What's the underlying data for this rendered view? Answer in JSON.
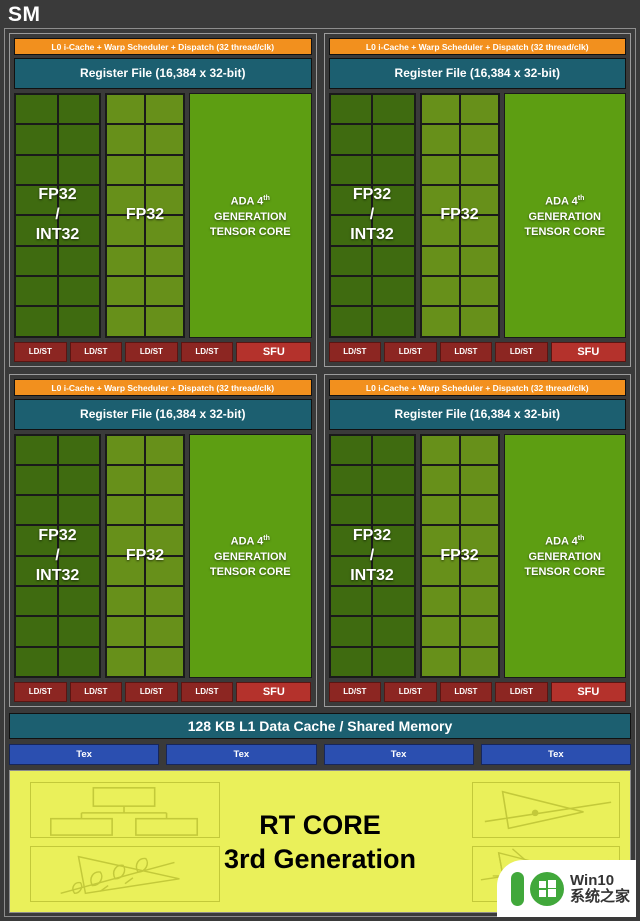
{
  "diagram": {
    "title": "SM",
    "subsections": {
      "scheduler_label": "L0 i-Cache + Warp Scheduler + Dispatch (32 thread/clk)",
      "register_file_label": "Register File (16,384 x 32-bit)",
      "fp32_int32_label_line1": "FP32",
      "fp32_int32_label_line2": "/",
      "fp32_int32_label_line3": "INT32",
      "fp32_label": "FP32",
      "tensor_core_line1_prefix": "ADA 4",
      "tensor_core_line1_sup": "th",
      "tensor_core_line2": "GENERATION",
      "tensor_core_line3": "TENSOR CORE",
      "ldst_label": "LD/ST",
      "sfu_label": "SFU"
    },
    "l1_cache_label": "128 KB L1 Data Cache / Shared Memory",
    "tex_label": "Tex",
    "tex_count": 4,
    "rt_core": {
      "line1": "RT CORE",
      "line2": "3rd Generation",
      "icons": [
        "bvh-tree-icon",
        "triangle-foliage-icon",
        "ray-triangle-intersection-icon",
        "ray-mesh-intersection-icon"
      ]
    },
    "quadrant_count": 4,
    "ldst_per_quadrant": 4,
    "core_rows": 8,
    "core_cols": 2,
    "colors": {
      "background": "#3a3a3a",
      "scheduler": "#f2901e",
      "register_file": "#1c5f70",
      "fp32_int32": "#3f6b10",
      "fp32": "#67901a",
      "tensor_core": "#5d9e12",
      "ldst": "#8c2622",
      "sfu": "#b4322c",
      "l1_cache": "#1c5f70",
      "tex": "#2b4fb0",
      "rt_core": "#eaf05a"
    }
  },
  "watermark": {
    "number": "10",
    "line1": "Win10",
    "line2": "系统之家"
  }
}
